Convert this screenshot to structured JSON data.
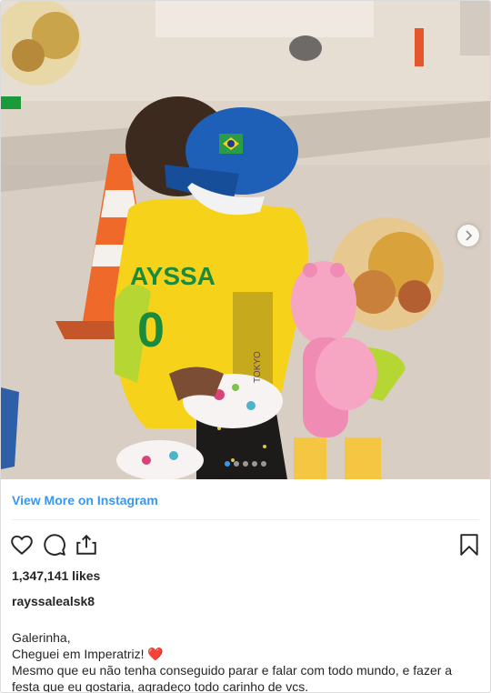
{
  "post": {
    "view_more_label": "View More on Instagram",
    "likes_text": "1,347,141 likes",
    "username": "rayssalealsk8",
    "caption_lines": [
      "Galerinha,",
      "Cheguei em Imperatriz! ❤️",
      "Mesmo que eu não tenha conseguido parar e falar com todo mundo, e fazer a festa que eu gostaria, agradeço todo carinho de vcs."
    ],
    "photo_jersey_text": "AYSSA",
    "photo_jersey_number": "0",
    "photo_medal_text": "TOKYO",
    "carousel": {
      "count": 5,
      "active_index": 0
    },
    "icons": {
      "like": "heart-icon",
      "comment": "comment-icon",
      "share": "share-icon",
      "save": "bookmark-icon",
      "next": "chevron-right-icon"
    },
    "colors": {
      "link": "#3897f0",
      "text": "#262626",
      "border": "#dbdbdb"
    }
  }
}
